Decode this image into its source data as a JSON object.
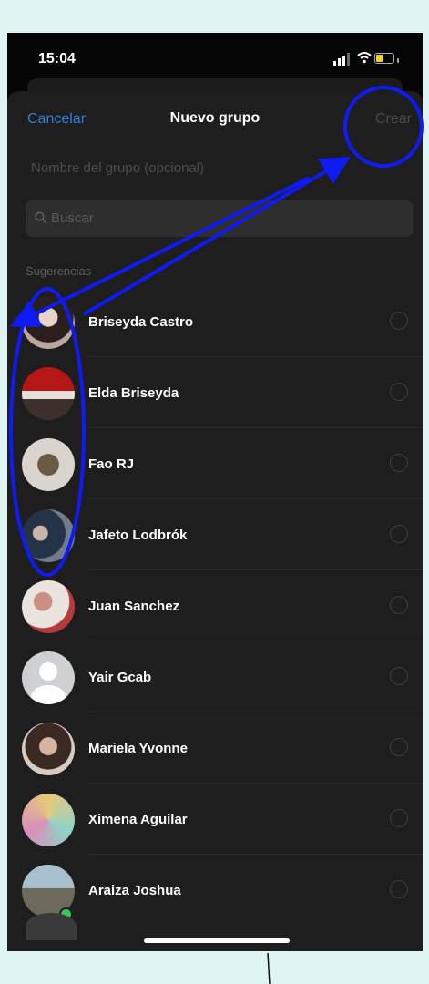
{
  "status": {
    "time": "15:04"
  },
  "nav": {
    "cancel": "Cancelar",
    "title": "Nuevo grupo",
    "create": "Crear"
  },
  "group_name": {
    "placeholder": "Nombre del grupo (opcional)"
  },
  "search": {
    "placeholder": "Buscar"
  },
  "section_header": "Sugerencias",
  "contacts": [
    {
      "name": "Briseyda Castro",
      "avatar": "photo"
    },
    {
      "name": "Elda Briseyda",
      "avatar": "photo"
    },
    {
      "name": "Fao RJ",
      "avatar": "photo"
    },
    {
      "name": "Jafeto Lodbrók",
      "avatar": "photo"
    },
    {
      "name": "Juan Sanchez",
      "avatar": "photo"
    },
    {
      "name": "Yair Gcab",
      "avatar": "default-person-icon"
    },
    {
      "name": "Mariela Yvonne",
      "avatar": "photo"
    },
    {
      "name": "Ximena Aguilar",
      "avatar": "photo"
    },
    {
      "name": "Araiza Joshua",
      "avatar": "photo",
      "online": true
    }
  ],
  "colors": {
    "accent_blue": "#2f7fdb",
    "annotation_blue": "#0f1bf2",
    "online_green": "#35c75a",
    "background": "#dff5f3"
  }
}
